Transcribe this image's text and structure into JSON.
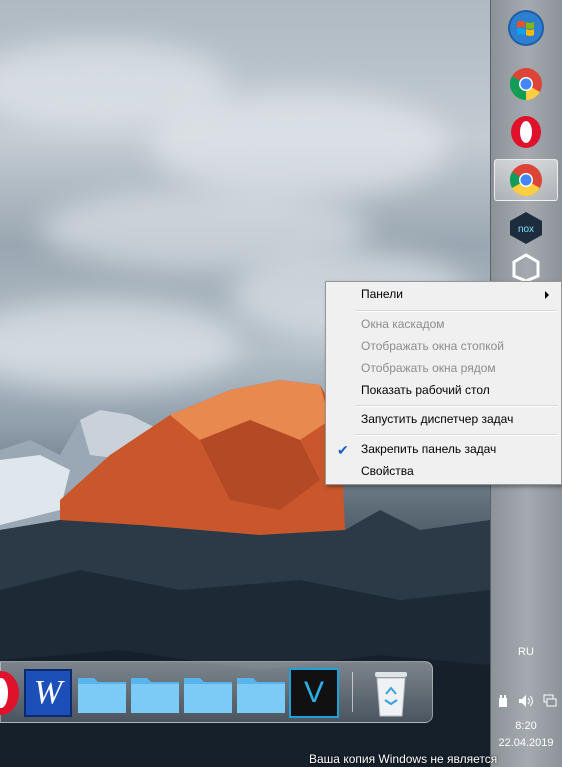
{
  "context_menu": {
    "items": [
      {
        "label": "Панели",
        "has_submenu": true,
        "enabled": true
      },
      {
        "label": "Окна каскадом",
        "enabled": false
      },
      {
        "label": "Отображать окна стопкой",
        "enabled": false
      },
      {
        "label": "Отображать окна рядом",
        "enabled": false
      },
      {
        "label": "Показать рабочий стол",
        "enabled": true
      },
      {
        "label": "Запустить диспетчер задач",
        "enabled": true
      },
      {
        "label": "Закрепить панель задач",
        "enabled": true,
        "checked": true
      },
      {
        "label": "Свойства",
        "enabled": true
      }
    ]
  },
  "taskbar": {
    "pinned": [
      {
        "icon": "windows-start-orb-icon"
      },
      {
        "icon": "chrome-icon"
      },
      {
        "icon": "opera-icon"
      },
      {
        "icon": "chrome-icon",
        "active": true
      },
      {
        "icon": "nox-icon"
      },
      {
        "icon": "unity-icon"
      }
    ],
    "tray": {
      "language": "RU",
      "time": "8:20",
      "date": "22.04.2019",
      "icons": [
        "power-plug-icon",
        "volume-icon",
        "network-icon"
      ]
    }
  },
  "dock": {
    "items": [
      {
        "icon": "opera-icon"
      },
      {
        "icon": "word-icon",
        "glyph": "W"
      },
      {
        "icon": "folder-icon"
      },
      {
        "icon": "folder-icon"
      },
      {
        "icon": "folder-icon"
      },
      {
        "icon": "folder-icon"
      },
      {
        "icon": "vegas-icon",
        "glyph": "V"
      },
      {
        "icon": "recycle-bin-icon"
      }
    ]
  },
  "activation_notice": "Ваша копия Windows не является",
  "colors": {
    "menu_bg": "#f0f0f0",
    "disabled_text": "#8c8c8c",
    "check": "#1a5fc8",
    "taskbar": "#9ca3a9"
  }
}
